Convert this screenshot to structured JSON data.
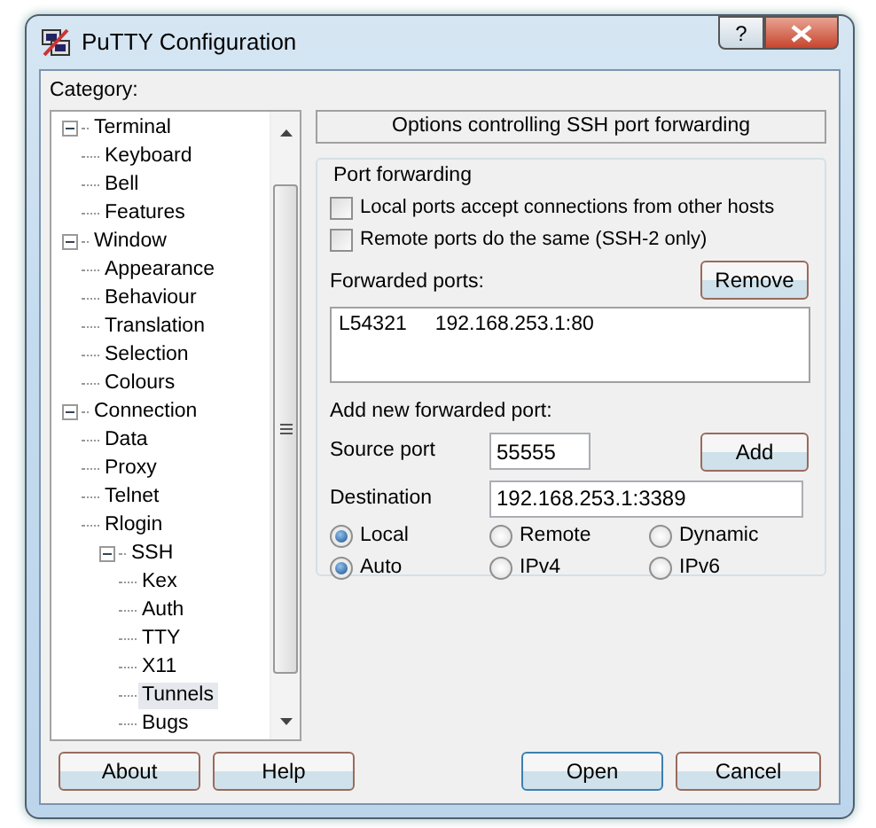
{
  "window": {
    "title": "PuTTY Configuration",
    "help_glyph": "?"
  },
  "category_label": "Category:",
  "tree": [
    {
      "label": "Terminal",
      "selected": false,
      "expanded": true,
      "children": [
        {
          "label": "Keyboard",
          "selected": false
        },
        {
          "label": "Bell",
          "selected": false
        },
        {
          "label": "Features",
          "selected": false
        }
      ]
    },
    {
      "label": "Window",
      "selected": false,
      "expanded": true,
      "children": [
        {
          "label": "Appearance",
          "selected": false
        },
        {
          "label": "Behaviour",
          "selected": false
        },
        {
          "label": "Translation",
          "selected": false
        },
        {
          "label": "Selection",
          "selected": false
        },
        {
          "label": "Colours",
          "selected": false
        }
      ]
    },
    {
      "label": "Connection",
      "selected": false,
      "expanded": true,
      "children": [
        {
          "label": "Data",
          "selected": false
        },
        {
          "label": "Proxy",
          "selected": false
        },
        {
          "label": "Telnet",
          "selected": false
        },
        {
          "label": "Rlogin",
          "selected": false
        },
        {
          "label": "SSH",
          "selected": false,
          "expanded": true,
          "children": [
            {
              "label": "Kex",
              "selected": false
            },
            {
              "label": "Auth",
              "selected": false
            },
            {
              "label": "TTY",
              "selected": false
            },
            {
              "label": "X11",
              "selected": false
            },
            {
              "label": "Tunnels",
              "selected": true
            },
            {
              "label": "Bugs",
              "selected": false
            }
          ]
        }
      ]
    }
  ],
  "panel_title": "Options controlling SSH port forwarding",
  "group": {
    "title": "Port forwarding",
    "checkboxes": [
      {
        "label": "Local ports accept connections from other hosts",
        "checked": false
      },
      {
        "label": "Remote ports do the same (SSH-2 only)",
        "checked": false
      }
    ],
    "forwarded_ports_label": "Forwarded ports:",
    "remove_button": "Remove",
    "forwarded_ports": [
      {
        "source": "L54321",
        "destination": "192.168.253.1:80"
      }
    ],
    "add_new_label": "Add new forwarded port:",
    "source_port": {
      "label": "Source port",
      "value": "55555"
    },
    "add_button": "Add",
    "destination": {
      "label": "Destination",
      "value": "192.168.253.1:3389"
    },
    "radio_rows": [
      [
        {
          "label": "Local",
          "selected": true
        },
        {
          "label": "Remote",
          "selected": false
        },
        {
          "label": "Dynamic",
          "selected": false
        }
      ],
      [
        {
          "label": "Auto",
          "selected": true
        },
        {
          "label": "IPv4",
          "selected": false
        },
        {
          "label": "IPv6",
          "selected": false
        }
      ]
    ]
  },
  "footer_buttons": [
    {
      "label": "About",
      "default": false
    },
    {
      "label": "Help",
      "default": false
    },
    {
      "label": "Open",
      "default": true
    },
    {
      "label": "Cancel",
      "default": false
    }
  ]
}
